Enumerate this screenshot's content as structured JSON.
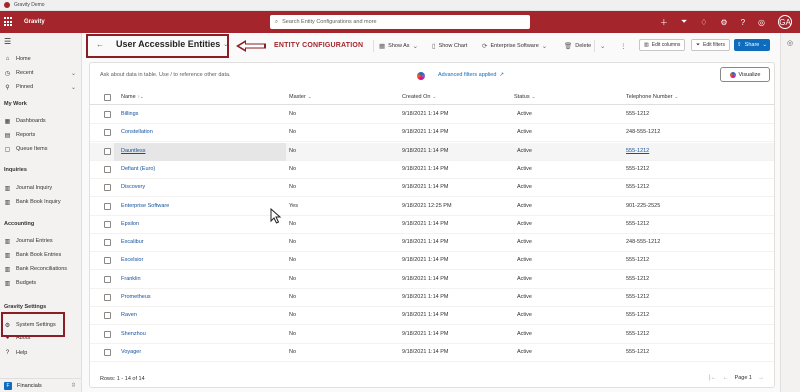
{
  "window": {
    "title": "Gravity Demo"
  },
  "header": {
    "app_name": "Gravity",
    "search_placeholder": "Search Entity Configurations and more",
    "avatar_initials": "GA",
    "icons": [
      "plus-icon",
      "filter-icon",
      "lightbulb-icon",
      "bell-icon",
      "gear-icon",
      "help-icon",
      "copilot-icon"
    ]
  },
  "nav": {
    "items": [
      {
        "label": "Home",
        "icon": "home-icon"
      },
      {
        "label": "Recent",
        "icon": "clock-icon"
      },
      {
        "label": "Pinned",
        "icon": "pin-icon"
      }
    ],
    "sections": [
      {
        "title": "My Work",
        "items": [
          "Dashboards",
          "Reports",
          "Queue Items"
        ]
      },
      {
        "title": "Inquiries",
        "items": [
          "Journal Inquiry",
          "Bank Book Inquiry"
        ]
      },
      {
        "title": "Accounting",
        "items": [
          "Journal Entries",
          "Bank Book Entries",
          "Bank Reconciliations",
          "Budgets"
        ]
      },
      {
        "title": "Gravity Settings",
        "items": [
          "System Settings",
          "About",
          "Help"
        ]
      }
    ],
    "area": {
      "badge": "F",
      "label": "Financials"
    }
  },
  "commandbar": {
    "view_name": "User Accessible Entities",
    "annotation": "ENTITY CONFIGURATION",
    "show_as": "Show As",
    "show_chart": "Show Chart",
    "enterprise_software": "Enterprise Software",
    "delete": "Delete",
    "edit_columns": "Edit columns",
    "edit_filters": "Edit filters",
    "share": "Share"
  },
  "grid": {
    "ask_placeholder": "Ask about data in table. Use / to reference other data.",
    "advanced_filters": "Advanced filters applied",
    "visualize": "Visualize",
    "columns": [
      "Name",
      "Master",
      "Created On",
      "Status",
      "Telephone Number"
    ],
    "rows": [
      {
        "name": "Billings",
        "master": "No",
        "created": "9/18/2021 1:14 PM",
        "status": "Active",
        "phone": "555-1212"
      },
      {
        "name": "Constellation",
        "master": "No",
        "created": "9/18/2021 1:14 PM",
        "status": "Active",
        "phone": "248-555-1212"
      },
      {
        "name": "Dauntless",
        "master": "No",
        "created": "9/18/2021 1:14 PM",
        "status": "Active",
        "phone": "555-1212"
      },
      {
        "name": "Defiant (Euro)",
        "master": "No",
        "created": "9/18/2021 1:14 PM",
        "status": "Active",
        "phone": "555-1212"
      },
      {
        "name": "Discovery",
        "master": "No",
        "created": "9/18/2021 1:14 PM",
        "status": "Active",
        "phone": "555-1212"
      },
      {
        "name": "Enterprise Software",
        "master": "Yes",
        "created": "9/18/2021 12:25 PM",
        "status": "Active",
        "phone": "901-225-2525"
      },
      {
        "name": "Epsilon",
        "master": "No",
        "created": "9/18/2021 1:14 PM",
        "status": "Active",
        "phone": "555-1212"
      },
      {
        "name": "Excalibur",
        "master": "No",
        "created": "9/18/2021 1:14 PM",
        "status": "Active",
        "phone": "248-555-1212"
      },
      {
        "name": "Excelsior",
        "master": "No",
        "created": "9/18/2021 1:14 PM",
        "status": "Active",
        "phone": "555-1212"
      },
      {
        "name": "Franklin",
        "master": "No",
        "created": "9/18/2021 1:14 PM",
        "status": "Active",
        "phone": "555-1212"
      },
      {
        "name": "Prometheus",
        "master": "No",
        "created": "9/18/2021 1:14 PM",
        "status": "Active",
        "phone": "555-1212"
      },
      {
        "name": "Raven",
        "master": "No",
        "created": "9/18/2021 1:14 PM",
        "status": "Active",
        "phone": "555-1212"
      },
      {
        "name": "Shenzhou",
        "master": "No",
        "created": "9/18/2021 1:14 PM",
        "status": "Active",
        "phone": "555-1212"
      },
      {
        "name": "Voyager",
        "master": "No",
        "created": "9/18/2021 1:14 PM",
        "status": "Active",
        "phone": "555-1212"
      }
    ],
    "rows_summary": "Rows: 1 - 14 of 14",
    "page_label": "Page 1"
  },
  "colors": {
    "brand": "#a4262c",
    "annotation": "#8b1e24",
    "link": "#11509c",
    "share": "#0f6cbd"
  }
}
